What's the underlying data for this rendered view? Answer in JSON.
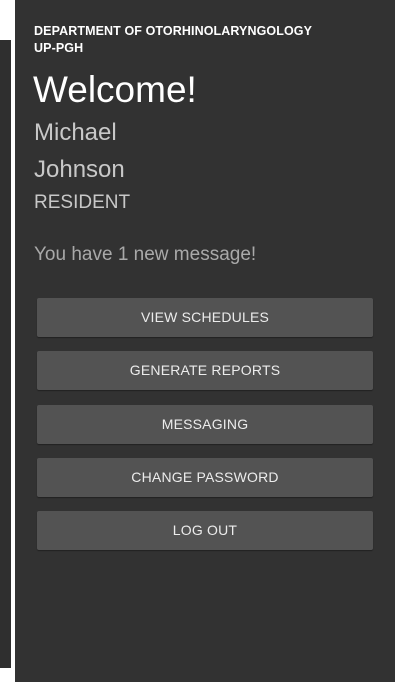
{
  "header": {
    "department_line1": "DEPARTMENT OF OTORHINOLARYNGOLOGY",
    "department_line2": "UP-PGH"
  },
  "welcome": {
    "greeting": "Welcome!",
    "first_name": "Michael",
    "last_name": "Johnson",
    "role": "RESIDENT",
    "message_notice": "You have 1 new message!"
  },
  "menu": {
    "view_schedules": "VIEW SCHEDULES",
    "generate_reports": "GENERATE REPORTS",
    "messaging": "MESSAGING",
    "change_password": "CHANGE PASSWORD",
    "log_out": "LOG OUT"
  },
  "colors": {
    "panel_background": "#323232",
    "button_background": "#535353",
    "primary_text": "#ffffff",
    "secondary_text": "#c8c8c8"
  }
}
